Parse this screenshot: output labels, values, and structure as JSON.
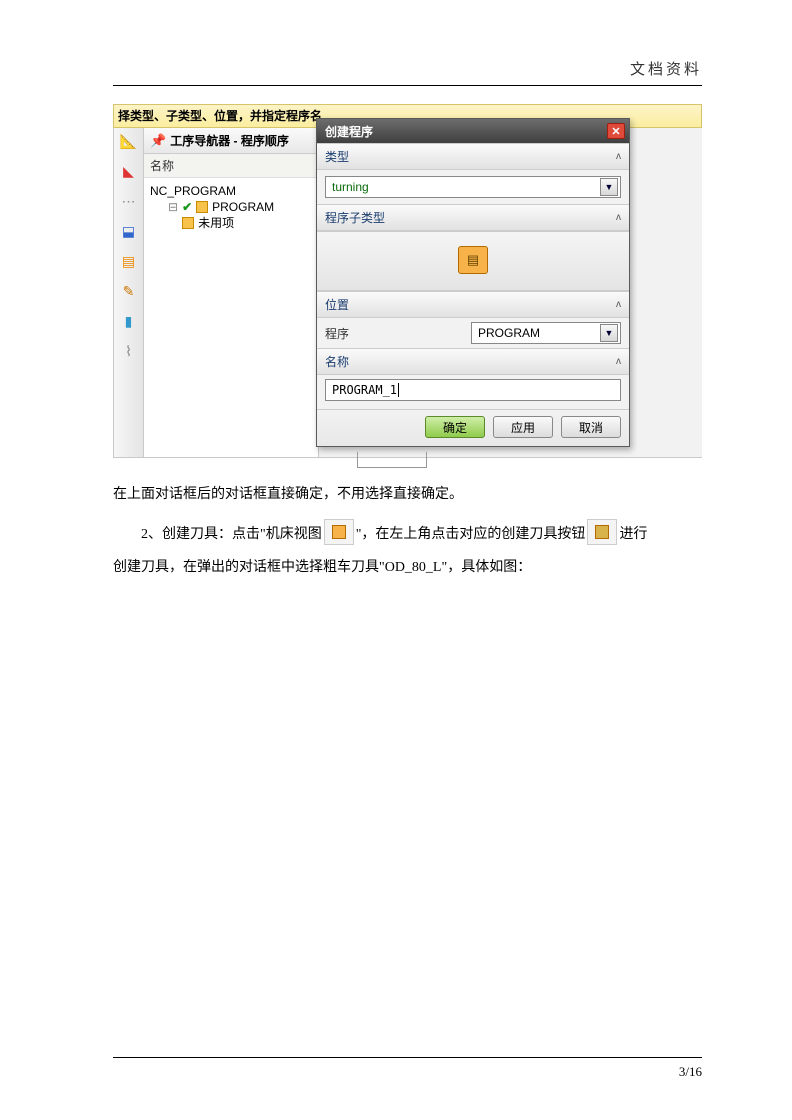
{
  "header": {
    "title": "文档资料"
  },
  "caption": "择类型、子类型、位置，并指定程序名",
  "nav": {
    "title": "工序导航器 - 程序顺序",
    "col_name": "名称",
    "root": "NC_PROGRAM",
    "children": [
      "PROGRAM",
      "未用项"
    ]
  },
  "dialog": {
    "title": "创建程序",
    "sections": {
      "type_label": "类型",
      "type_value": "turning",
      "subtype_label": "程序子类型",
      "location_label": "位置",
      "program_label": "程序",
      "program_value": "PROGRAM",
      "name_label": "名称",
      "name_value": "PROGRAM_1"
    },
    "buttons": {
      "ok": "确定",
      "apply": "应用",
      "cancel": "取消"
    }
  },
  "body": {
    "line1": "在上面对话框后的对话框直接确定，不用选择直接确定。",
    "line2a": "2、创建刀具：点击\"机床视图",
    "line2b": "\"，在左上角点击对应的创建刀具按钮",
    "line2c": "进行",
    "line3": "创建刀具，在弹出的对话框中选择粗车刀具\"OD_80_L\"，具体如图："
  },
  "footer": {
    "page": "3/16"
  }
}
